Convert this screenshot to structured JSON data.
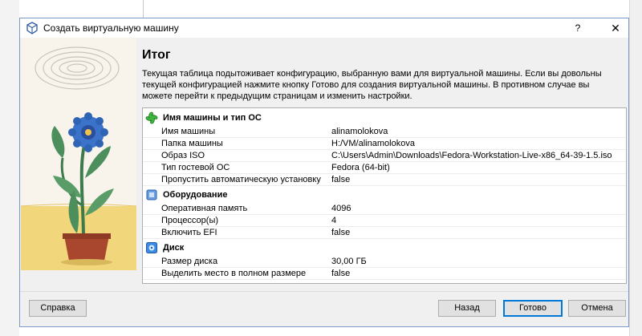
{
  "window": {
    "title": "Создать виртуальную машину",
    "help_glyph": "?",
    "close_glyph": "✕"
  },
  "page": {
    "heading": "Итог",
    "description": "Текущая таблица подытоживает конфигурацию, выбранную вами для виртуальной машины. Если вы довольны текущей конфигурацией нажмите кнопку Готово для создания виртуальной машины. В противном случае вы можете перейти к предыдущим страницам и изменить настройки."
  },
  "summary": {
    "name_os": {
      "title": "Имя машины и тип ОС",
      "icon": "green-puzzle-icon",
      "rows": [
        {
          "key": "Имя машины",
          "value": "alinamolokova"
        },
        {
          "key": "Папка машины",
          "value": "H:/VM/alinamolokova"
        },
        {
          "key": "Образ ISO",
          "value": "C:\\Users\\Admin\\Downloads\\Fedora-Workstation-Live-x86_64-39-1.5.iso"
        },
        {
          "key": "Тип гостевой ОС",
          "value": "Fedora (64-bit)"
        },
        {
          "key": "Пропустить автоматическую установку",
          "value": "false"
        }
      ]
    },
    "hardware": {
      "title": "Оборудование",
      "icon": "chip-icon",
      "rows": [
        {
          "key": "Оперативная память",
          "value": "4096"
        },
        {
          "key": "Процессор(ы)",
          "value": "4"
        },
        {
          "key": "Включить EFI",
          "value": "false"
        }
      ]
    },
    "disk": {
      "title": "Диск",
      "icon": "disk-icon",
      "rows": [
        {
          "key": "Размер диска",
          "value": "30,00 ГБ"
        },
        {
          "key": "Выделить место в полном размере",
          "value": "false"
        }
      ]
    }
  },
  "buttons": {
    "help": "Справка",
    "back": "Назад",
    "finish": "Готово",
    "cancel": "Отмена"
  },
  "colors": {
    "dialog_bg": "#f0f0f0",
    "accent": "#0078d7",
    "border": "#7a99c9"
  }
}
